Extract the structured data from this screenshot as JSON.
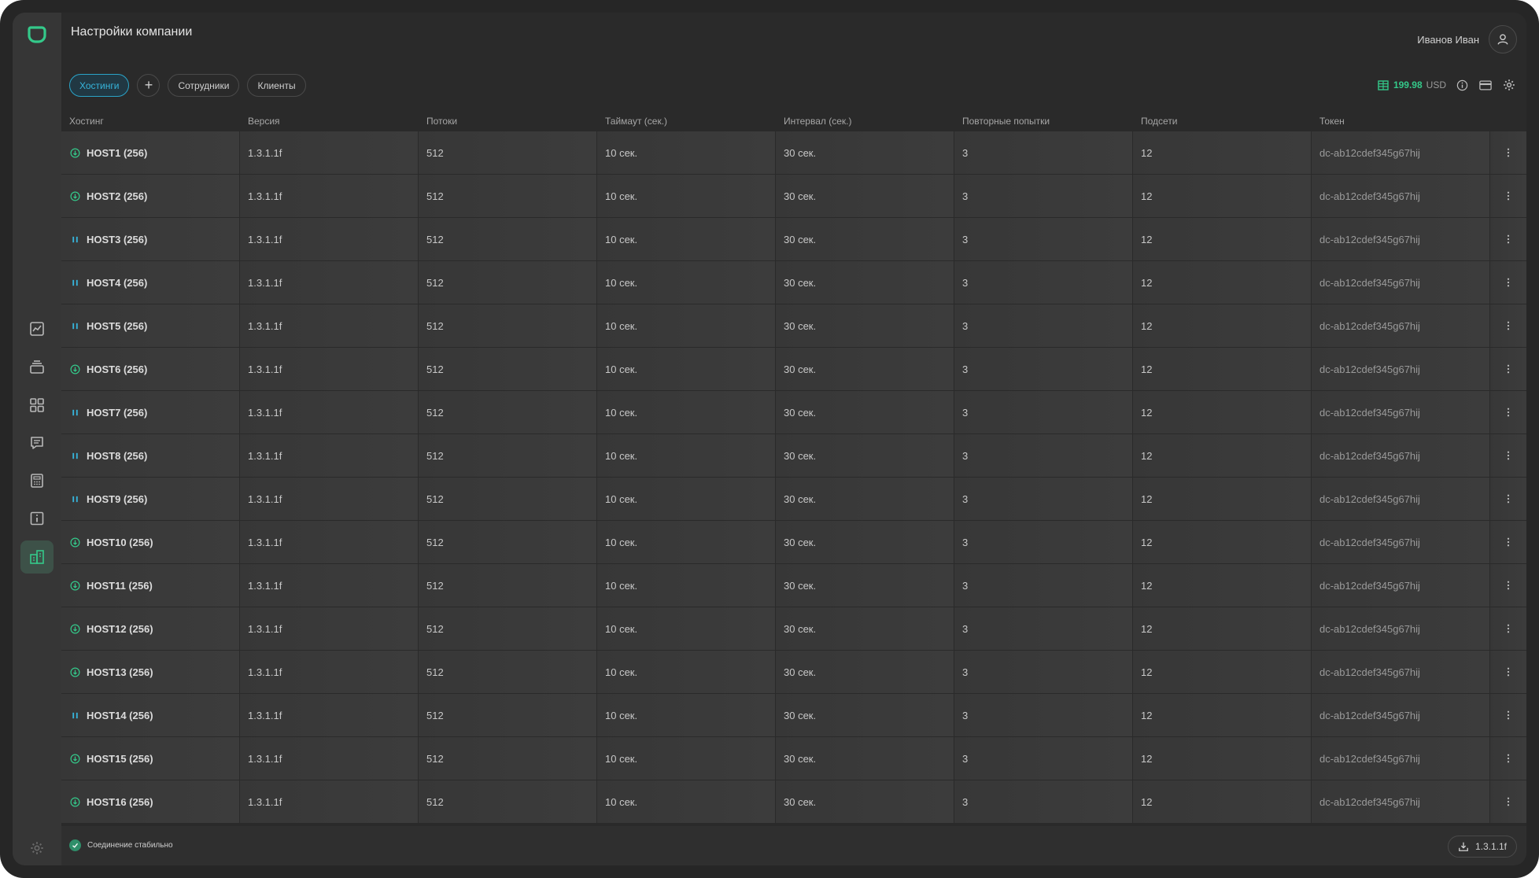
{
  "page": {
    "title": "Настройки компании"
  },
  "user": {
    "name": "Иванов Иван"
  },
  "tabs": [
    {
      "label": "Хостинги",
      "active": true
    },
    {
      "label": "+",
      "active": false
    },
    {
      "label": "Сотрудники",
      "active": false
    },
    {
      "label": "Клиенты",
      "active": false
    }
  ],
  "balance": {
    "amount": "199.98",
    "currency": "USD"
  },
  "sidebar": {
    "items": [
      {
        "icon": "chart-line-icon"
      },
      {
        "icon": "layers-icon"
      },
      {
        "icon": "grid-icon"
      },
      {
        "icon": "message-icon"
      },
      {
        "icon": "calculator-icon"
      },
      {
        "icon": "info-icon"
      },
      {
        "icon": "buildings-icon",
        "active": true
      }
    ]
  },
  "table": {
    "columns": [
      "Хостинг",
      "Версия",
      "Потоки",
      "Таймаут (сек.)",
      "Интервал (сек.)",
      "Повторные попытки",
      "Подсети",
      "Токен"
    ],
    "rows": [
      {
        "name": "HOST1 (256)",
        "status": "online",
        "version": "1.3.1.1f",
        "threads": "512",
        "timeout": "10 сек.",
        "interval": "30 сек.",
        "retries": "3",
        "subnets": "12",
        "token": "dc-ab12cdef345g67hij"
      },
      {
        "name": "HOST2 (256)",
        "status": "online",
        "version": "1.3.1.1f",
        "threads": "512",
        "timeout": "10 сек.",
        "interval": "30 сек.",
        "retries": "3",
        "subnets": "12",
        "token": "dc-ab12cdef345g67hij"
      },
      {
        "name": "HOST3 (256)",
        "status": "paused",
        "version": "1.3.1.1f",
        "threads": "512",
        "timeout": "10 сек.",
        "interval": "30 сек.",
        "retries": "3",
        "subnets": "12",
        "token": "dc-ab12cdef345g67hij"
      },
      {
        "name": "HOST4 (256)",
        "status": "paused",
        "version": "1.3.1.1f",
        "threads": "512",
        "timeout": "10 сек.",
        "interval": "30 сек.",
        "retries": "3",
        "subnets": "12",
        "token": "dc-ab12cdef345g67hij"
      },
      {
        "name": "HOST5 (256)",
        "status": "paused",
        "version": "1.3.1.1f",
        "threads": "512",
        "timeout": "10 сек.",
        "interval": "30 сек.",
        "retries": "3",
        "subnets": "12",
        "token": "dc-ab12cdef345g67hij"
      },
      {
        "name": "HOST6 (256)",
        "status": "online",
        "version": "1.3.1.1f",
        "threads": "512",
        "timeout": "10 сек.",
        "interval": "30 сек.",
        "retries": "3",
        "subnets": "12",
        "token": "dc-ab12cdef345g67hij"
      },
      {
        "name": "HOST7 (256)",
        "status": "paused",
        "version": "1.3.1.1f",
        "threads": "512",
        "timeout": "10 сек.",
        "interval": "30 сек.",
        "retries": "3",
        "subnets": "12",
        "token": "dc-ab12cdef345g67hij"
      },
      {
        "name": "HOST8 (256)",
        "status": "paused",
        "version": "1.3.1.1f",
        "threads": "512",
        "timeout": "10 сек.",
        "interval": "30 сек.",
        "retries": "3",
        "subnets": "12",
        "token": "dc-ab12cdef345g67hij"
      },
      {
        "name": "HOST9 (256)",
        "status": "paused",
        "version": "1.3.1.1f",
        "threads": "512",
        "timeout": "10 сек.",
        "interval": "30 сек.",
        "retries": "3",
        "subnets": "12",
        "token": "dc-ab12cdef345g67hij"
      },
      {
        "name": "HOST10 (256)",
        "status": "online",
        "version": "1.3.1.1f",
        "threads": "512",
        "timeout": "10 сек.",
        "interval": "30 сек.",
        "retries": "3",
        "subnets": "12",
        "token": "dc-ab12cdef345g67hij"
      },
      {
        "name": "HOST11 (256)",
        "status": "online",
        "version": "1.3.1.1f",
        "threads": "512",
        "timeout": "10 сек.",
        "interval": "30 сек.",
        "retries": "3",
        "subnets": "12",
        "token": "dc-ab12cdef345g67hij"
      },
      {
        "name": "HOST12 (256)",
        "status": "online",
        "version": "1.3.1.1f",
        "threads": "512",
        "timeout": "10 сек.",
        "interval": "30 сек.",
        "retries": "3",
        "subnets": "12",
        "token": "dc-ab12cdef345g67hij"
      },
      {
        "name": "HOST13 (256)",
        "status": "online",
        "version": "1.3.1.1f",
        "threads": "512",
        "timeout": "10 сек.",
        "interval": "30 сек.",
        "retries": "3",
        "subnets": "12",
        "token": "dc-ab12cdef345g67hij"
      },
      {
        "name": "HOST14 (256)",
        "status": "paused",
        "version": "1.3.1.1f",
        "threads": "512",
        "timeout": "10 сек.",
        "interval": "30 сек.",
        "retries": "3",
        "subnets": "12",
        "token": "dc-ab12cdef345g67hij"
      },
      {
        "name": "HOST15 (256)",
        "status": "online",
        "version": "1.3.1.1f",
        "threads": "512",
        "timeout": "10 сек.",
        "interval": "30 сек.",
        "retries": "3",
        "subnets": "12",
        "token": "dc-ab12cdef345g67hij"
      },
      {
        "name": "HOST16 (256)",
        "status": "online",
        "version": "1.3.1.1f",
        "threads": "512",
        "timeout": "10 сек.",
        "interval": "30 сек.",
        "retries": "3",
        "subnets": "12",
        "token": "dc-ab12cdef345g67hij"
      }
    ]
  },
  "footer": {
    "connection_status": "Соединение стабильно",
    "version": "1.3.1.1f"
  },
  "colors": {
    "accent_green": "#34c98a",
    "accent_blue": "#36b5dc",
    "background": "#2a2a2a",
    "row": "#3a3a3a"
  }
}
